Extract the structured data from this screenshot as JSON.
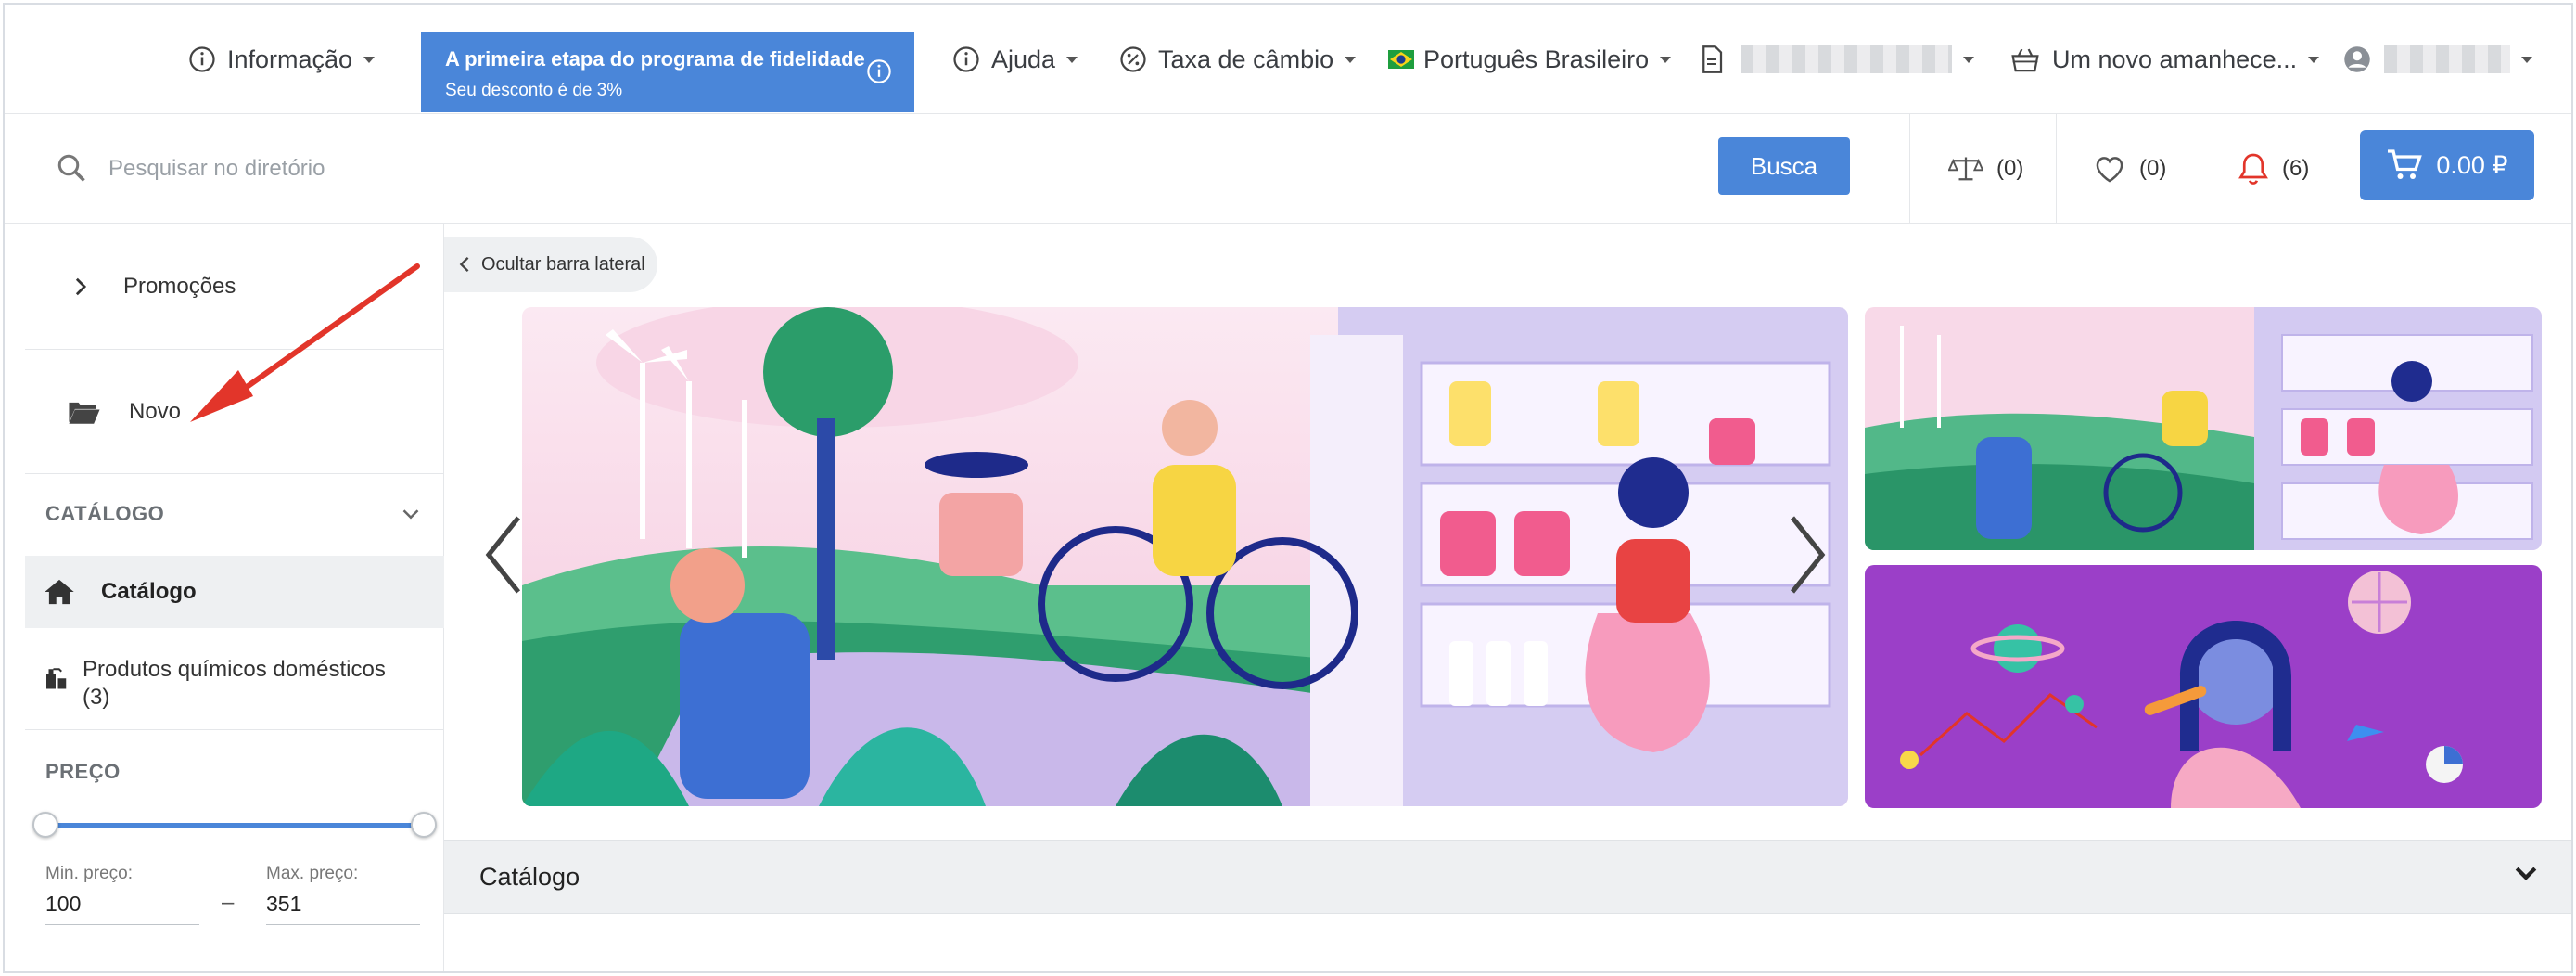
{
  "header": {
    "info_label": "Informação",
    "loyalty_title": "A primeira etapa do programa de fidelidade",
    "loyalty_subtitle": "Seu desconto é de 3%",
    "help_label": "Ajuda",
    "exchange_label": "Taxa de câmbio",
    "language_label": "Português Brasileiro",
    "tagline_label": "Um novo amanhece..."
  },
  "search": {
    "placeholder": "Pesquisar no diretório",
    "button_label": "Busca"
  },
  "counters": {
    "compare": "(0)",
    "favorites": "(0)",
    "notifications": "(6)",
    "cart_total": "0.00 ₽"
  },
  "sidebar": {
    "promotions_label": "Promoções",
    "new_label": "Novo",
    "catalog_heading": "CATÁLOGO",
    "catalog_label": "Catálogo",
    "category_label": "Produtos químicos domésticos",
    "category_count": "(3)",
    "price_heading": "PREÇO",
    "min_label": "Min. preço:",
    "min_value": "100",
    "max_label": "Max. preço:",
    "max_value": "351",
    "price_range_fraction": [
      0,
      1
    ]
  },
  "main": {
    "hide_sidebar_label": "Ocultar barra lateral",
    "catalog_bar_label": "Catálogo"
  },
  "colors": {
    "accent": "#4a86d9",
    "annotation_arrow": "#e2352a",
    "notification": "#e2352a",
    "banner_purple": "#9b3fc8"
  },
  "icons": [
    "info-icon",
    "document-icon",
    "basket-icon",
    "user-icon",
    "percent-icon",
    "search-icon",
    "scales-icon",
    "heart-icon",
    "bell-icon",
    "cart-icon",
    "folder-open-icon",
    "home-icon",
    "chevron-right-icon",
    "chevron-down-icon",
    "chevron-left-icon"
  ]
}
